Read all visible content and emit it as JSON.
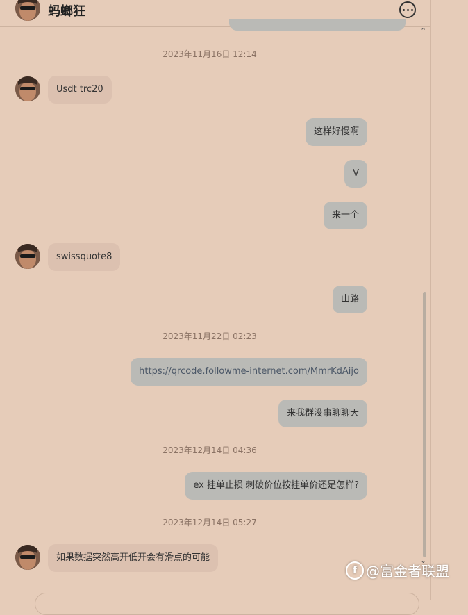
{
  "header": {
    "title": "蚂螂狂"
  },
  "messages": [
    {
      "type": "timestamp",
      "text": "2023年11月16日 12:14"
    },
    {
      "type": "incoming",
      "text": "Usdt trc20"
    },
    {
      "type": "outgoing",
      "text": "这样好慢啊"
    },
    {
      "type": "outgoing",
      "text": "V"
    },
    {
      "type": "outgoing",
      "text": "来一个"
    },
    {
      "type": "incoming",
      "text": "swissquote8"
    },
    {
      "type": "outgoing",
      "text": "山路"
    },
    {
      "type": "timestamp",
      "text": "2023年11月22日 02:23"
    },
    {
      "type": "outgoing",
      "text": "https://qrcode.followme-internet.com/MmrKdAijo",
      "link": true
    },
    {
      "type": "outgoing",
      "text": "来我群没事聊聊天"
    },
    {
      "type": "timestamp",
      "text": "2023年12月14日 04:36"
    },
    {
      "type": "outgoing",
      "text": "ex 挂单止损 刺破价位按挂单价还是怎样?"
    },
    {
      "type": "timestamp",
      "text": "2023年12月14日 05:27"
    },
    {
      "type": "incoming",
      "text": "如果数据突然高开低开会有滑点的可能"
    }
  ],
  "watermark": {
    "logo": "f",
    "text": "@富金者联盟"
  },
  "colors": {
    "background": "#e6ccb9",
    "incoming_bubble": "#dcc1b0",
    "outgoing_bubble": "#babab6"
  }
}
